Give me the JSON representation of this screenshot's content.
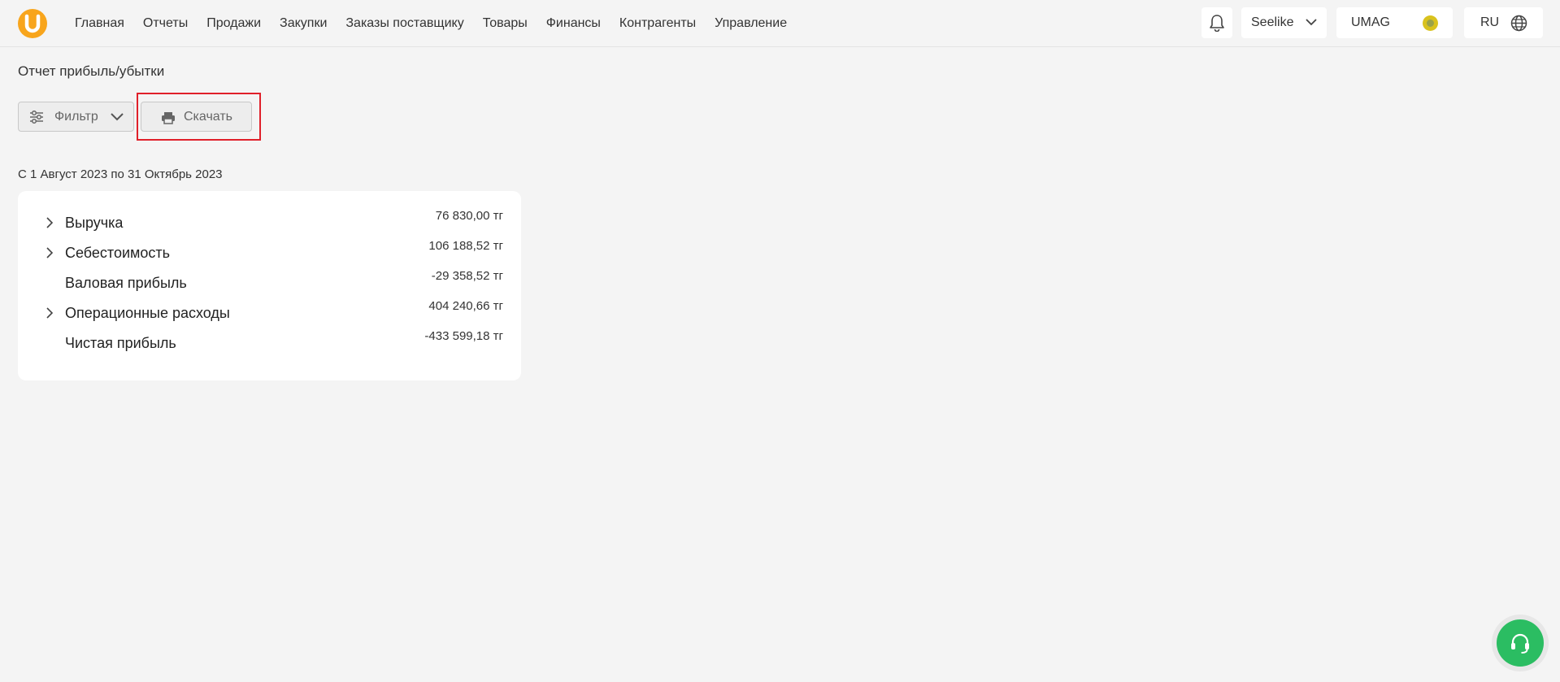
{
  "nav": {
    "items": [
      {
        "label": "Главная"
      },
      {
        "label": "Отчеты"
      },
      {
        "label": "Продажи"
      },
      {
        "label": "Закупки"
      },
      {
        "label": "Заказы поставщику"
      },
      {
        "label": "Товары"
      },
      {
        "label": "Финансы"
      },
      {
        "label": "Контрагенты"
      },
      {
        "label": "Управление"
      }
    ]
  },
  "header": {
    "store": "Seelike",
    "company": "UMAG",
    "language": "RU"
  },
  "page": {
    "title": "Отчет прибыль/убытки",
    "filter_label": "Фильтр",
    "download_label": "Скачать",
    "period": "С 1 Август 2023 по 31 Октябрь 2023"
  },
  "report": {
    "rows": [
      {
        "label": "Выручка",
        "amount": "76 830,00 тг",
        "expandable": true
      },
      {
        "label": "Себестоимость",
        "amount": "106 188,52 тг",
        "expandable": true
      },
      {
        "label": "Валовая прибыль",
        "amount": "-29 358,52 тг",
        "expandable": false
      },
      {
        "label": "Операционные расходы",
        "amount": "404 240,66 тг",
        "expandable": true
      },
      {
        "label": "Чистая прибыль",
        "amount": "-433 599,18 тг",
        "expandable": false
      }
    ]
  },
  "icons": {
    "logo": "umag-logo",
    "notifications": "bell-icon",
    "language": "globe-icon",
    "filter": "sliders-icon",
    "download": "printer-icon",
    "support": "headset-icon"
  },
  "colors": {
    "brand": "#f8a51c",
    "highlight": "#e0202a",
    "support": "#2bbd62",
    "background": "#f4f4f4"
  }
}
